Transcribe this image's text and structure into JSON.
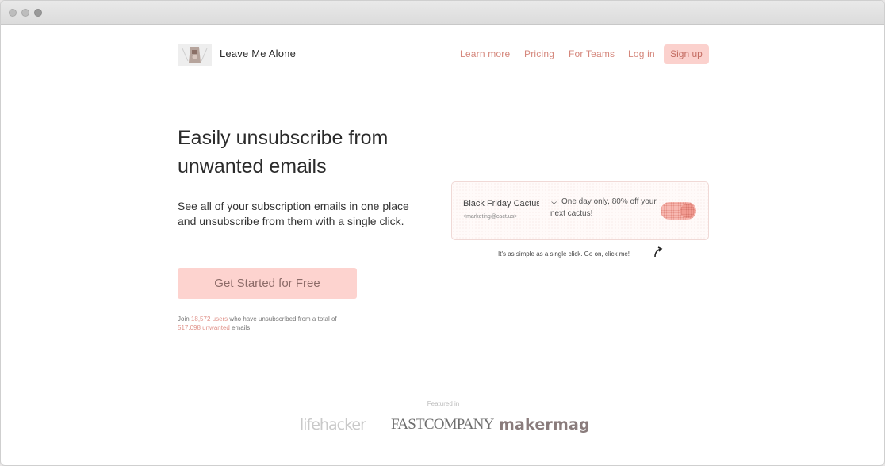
{
  "brand": {
    "name": "Leave Me Alone"
  },
  "nav": {
    "learn_more": "Learn more",
    "pricing": "Pricing",
    "for_teams": "For Teams",
    "login": "Log in",
    "signup": "Sign up"
  },
  "hero": {
    "headline": "Easily unsubscribe from unwanted emails",
    "subtext": "See all of your subscription emails in one place and unsubscribe from them with a single click.",
    "cta": "Get Started for Free",
    "stats": {
      "prefix": "Join",
      "users": "18,572 users",
      "middle": "who have unsubscribed from a total of",
      "emails": "517,098 unwanted",
      "suffix": "emails"
    }
  },
  "demo": {
    "sender": "Black Friday Cactus Sale",
    "sender_email": "<marketing@cact.us>",
    "subject": "One day only, 80% off your next cactus!",
    "subject_icon": "arrow-down-icon",
    "toggle_on": true,
    "hint": "It's as simple as a single click. Go on, click me!"
  },
  "featured": {
    "label": "Featured in",
    "logos": [
      "lifehacker",
      "FASTCOMPANY",
      "makermag"
    ]
  },
  "colors": {
    "accent": "#d5877c",
    "accent_bg": "#fbd1cd",
    "toggle": "#f19a90"
  }
}
